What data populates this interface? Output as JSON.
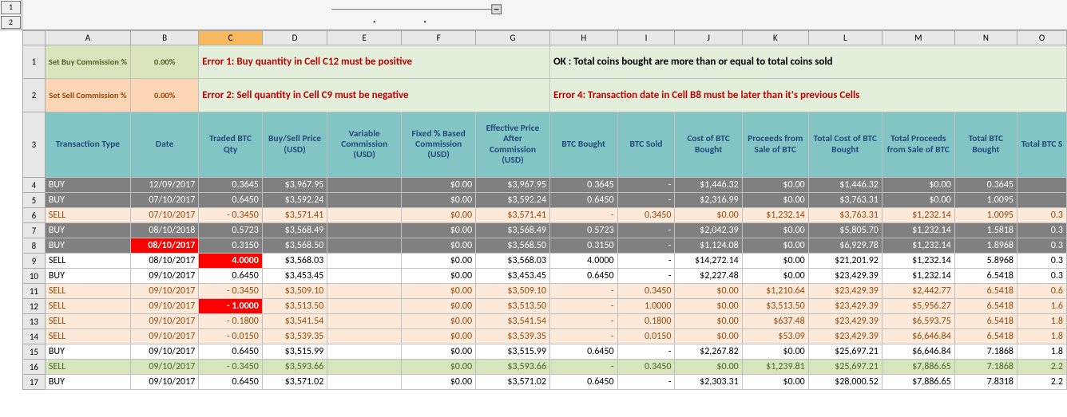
{
  "outline": {
    "levels": [
      "1",
      "2"
    ]
  },
  "col_letters": [
    "A",
    "B",
    "C",
    "D",
    "E",
    "F",
    "G",
    "H",
    "I",
    "J",
    "K",
    "L",
    "M",
    "N",
    "O"
  ],
  "selected_col": "C",
  "labels": {
    "set_buy": "Set Buy Commission %",
    "set_sell": "Set Sell Commission %",
    "pct_buy": "0.00%",
    "pct_sell": "0.00%",
    "err1": "Error 1: Buy quantity in Cell C12 must be positive",
    "err2": "Error 2: Sell quantity in Cell C9 must be negative",
    "ok_msg": "OK : Total coins bought are more than or equal to total coins sold",
    "err4": "Error 4: Transaction date in Cell B8 must be later than it's previous Cells"
  },
  "headers": [
    "Transaction Type",
    "Date",
    "Traded BTC Qty",
    "Buy/Sell Price (USD)",
    "Variable Commission (USD)",
    "Fixed % Based Commission (USD)",
    "Effective Price After Commission (USD)",
    "BTC Bought",
    "BTC Sold",
    "Cost of BTC Bought",
    "Proceeds from Sale of BTC",
    "Total Cost of BTC Bought",
    "Total Proceeds from Sale of BTC",
    "Total BTC Bought",
    "Total BTC S"
  ],
  "chart_data": {
    "type": "table",
    "columns": [
      "row",
      "Transaction Type",
      "Date",
      "Traded BTC Qty",
      "Buy/Sell Price (USD)",
      "Variable Commission (USD)",
      "Fixed % Based Commission (USD)",
      "Effective Price After Commission (USD)",
      "BTC Bought",
      "BTC Sold",
      "Cost of BTC Bought",
      "Proceeds from Sale of BTC",
      "Total Cost of BTC Bought",
      "Total Proceeds from Sale of BTC",
      "Total BTC Bought",
      "Total BTC Sold"
    ],
    "rows": [
      {
        "row": "4",
        "cls": "buy-row",
        "t": "BUY",
        "d": "12/09/2017",
        "q": "0.3645",
        "p": "$3,967.95",
        "v": "",
        "f": "$0.00",
        "e": "$3,967.95",
        "bb": "0.3645",
        "bs": "-",
        "cb": "$1,446.32",
        "ps": "$0.00",
        "tcb": "$1,446.32",
        "tps": "$0.00",
        "tbb": "0.3645",
        "tbs": ""
      },
      {
        "row": "5",
        "cls": "buy-row",
        "t": "BUY",
        "d": "07/10/2017",
        "q": "0.6450",
        "p": "$3,592.24",
        "v": "",
        "f": "$0.00",
        "e": "$3,592.24",
        "bb": "0.6450",
        "bs": "-",
        "cb": "$2,316.99",
        "ps": "$0.00",
        "tcb": "$3,763.31",
        "tps": "$0.00",
        "tbb": "1.0095",
        "tbs": ""
      },
      {
        "row": "6",
        "cls": "sell-row",
        "t": "SELL",
        "d": "07/10/2017",
        "q": "- 0.3450",
        "p": "$3,571.41",
        "v": "",
        "f": "$0.00",
        "e": "$3,571.41",
        "bb": "-",
        "bs": "0.3450",
        "cb": "$0.00",
        "ps": "$1,232.14",
        "tcb": "$3,763.31",
        "tps": "$1,232.14",
        "tbb": "1.0095",
        "tbs": "0.3"
      },
      {
        "row": "7",
        "cls": "buy-row",
        "t": "BUY",
        "d": "08/10/2018",
        "q": "0.5723",
        "p": "$3,568.49",
        "v": "",
        "f": "$0.00",
        "e": "$3,568.49",
        "bb": "0.5723",
        "bs": "-",
        "cb": "$2,042.39",
        "ps": "$0.00",
        "tcb": "$5,805.70",
        "tps": "$1,232.14",
        "tbb": "1.5818",
        "tbs": "0.3"
      },
      {
        "row": "8",
        "cls": "buy-row",
        "t": "BUY",
        "d": "08/10/2017",
        "q": "0.3150",
        "p": "$3,568.50",
        "v": "",
        "f": "$0.00",
        "e": "$3,568.50",
        "bb": "0.3150",
        "bs": "-",
        "cb": "$1,124.08",
        "ps": "$0.00",
        "tcb": "$6,929.78",
        "tps": "$1,232.14",
        "tbb": "1.8968",
        "tbs": "0.3",
        "date_err": true
      },
      {
        "row": "9",
        "cls": "norm-row",
        "t": "SELL",
        "d": "08/10/2017",
        "q": "4.0000",
        "p": "$3,568.03",
        "v": "",
        "f": "$0.00",
        "e": "$3,568.03",
        "bb": "4.0000",
        "bs": "-",
        "cb": "$14,272.14",
        "ps": "$0.00",
        "tcb": "$21,201.92",
        "tps": "$1,232.14",
        "tbb": "5.8968",
        "tbs": "0.3",
        "qty_err": true
      },
      {
        "row": "10",
        "cls": "norm-row",
        "t": "BUY",
        "d": "09/10/2017",
        "q": "0.6450",
        "p": "$3,453.45",
        "v": "",
        "f": "$0.00",
        "e": "$3,453.45",
        "bb": "0.6450",
        "bs": "-",
        "cb": "$2,227.48",
        "ps": "$0.00",
        "tcb": "$23,429.39",
        "tps": "$1,232.14",
        "tbb": "6.5418",
        "tbs": "0.3"
      },
      {
        "row": "11",
        "cls": "sell-row",
        "t": "SELL",
        "d": "09/10/2017",
        "q": "- 0.3450",
        "p": "$3,509.10",
        "v": "",
        "f": "$0.00",
        "e": "$3,509.10",
        "bb": "-",
        "bs": "0.3450",
        "cb": "$0.00",
        "ps": "$1,210.64",
        "tcb": "$23,429.39",
        "tps": "$2,442.77",
        "tbb": "6.5418",
        "tbs": "0.6"
      },
      {
        "row": "12",
        "cls": "sell-err",
        "t": "SELL",
        "d": "09/10/2017",
        "q": "- 1.0000",
        "p": "$3,513.50",
        "v": "",
        "f": "$0.00",
        "e": "$3,513.50",
        "bb": "-",
        "bs": "1.0000",
        "cb": "$0.00",
        "ps": "$3,513.50",
        "tcb": "$23,429.39",
        "tps": "$5,956.27",
        "tbb": "6.5418",
        "tbs": "1.6",
        "qty_err": true
      },
      {
        "row": "13",
        "cls": "sell-row",
        "t": "SELL",
        "d": "09/10/2017",
        "q": "- 0.1800",
        "p": "$3,541.54",
        "v": "",
        "f": "$0.00",
        "e": "$3,541.54",
        "bb": "-",
        "bs": "0.1800",
        "cb": "$0.00",
        "ps": "$637.48",
        "tcb": "$23,429.39",
        "tps": "$6,593.75",
        "tbb": "6.5418",
        "tbs": "1.8"
      },
      {
        "row": "14",
        "cls": "sell-row",
        "t": "SELL",
        "d": "09/10/2017",
        "q": "- 0.0150",
        "p": "$3,539.35",
        "v": "",
        "f": "$0.00",
        "e": "$3,539.35",
        "bb": "-",
        "bs": "0.0150",
        "cb": "$0.00",
        "ps": "$53.09",
        "tcb": "$23,429.39",
        "tps": "$6,646.84",
        "tbb": "6.5418",
        "tbs": "1.8"
      },
      {
        "row": "15",
        "cls": "norm-row",
        "t": "BUY",
        "d": "09/10/2017",
        "q": "0.6450",
        "p": "$3,515.99",
        "v": "",
        "f": "$0.00",
        "e": "$3,515.99",
        "bb": "0.6450",
        "bs": "-",
        "cb": "$2,267.82",
        "ps": "$0.00",
        "tcb": "$25,697.21",
        "tps": "$6,646.84",
        "tbb": "7.1868",
        "tbs": "1.8"
      },
      {
        "row": "16",
        "cls": "sellg-row",
        "t": "SELL",
        "d": "09/10/2017",
        "q": "- 0.3450",
        "p": "$3,593.66",
        "v": "",
        "f": "$0.00",
        "e": "$3,593.66",
        "bb": "-",
        "bs": "0.3450",
        "cb": "$0.00",
        "ps": "$1,239.81",
        "tcb": "$25,697.21",
        "tps": "$7,886.65",
        "tbb": "7.1868",
        "tbs": "2.2"
      },
      {
        "row": "17",
        "cls": "norm-row",
        "t": "BUY",
        "d": "09/10/2017",
        "q": "0.6450",
        "p": "$3,571.02",
        "v": "",
        "f": "$0.00",
        "e": "$3,571.02",
        "bb": "0.6450",
        "bs": "-",
        "cb": "$2,303.31",
        "ps": "$0.00",
        "tcb": "$28,000.52",
        "tps": "$7,886.65",
        "tbb": "7.8318",
        "tbs": "2.2"
      }
    ]
  }
}
